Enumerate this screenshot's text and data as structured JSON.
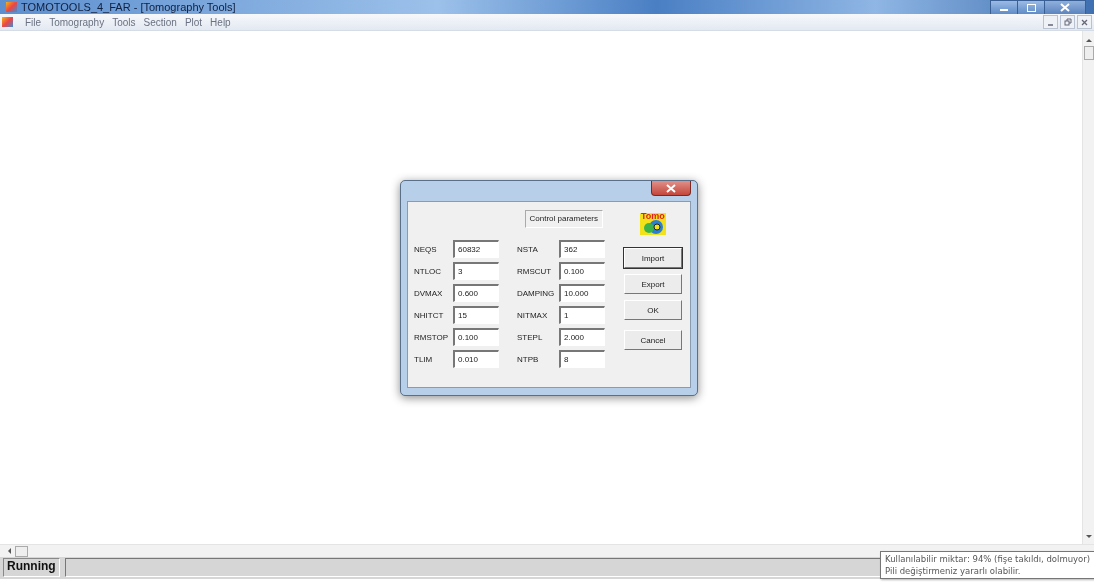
{
  "window": {
    "title": "TOMOTOOLS_4_FAR - [Tomography Tools]"
  },
  "menu": [
    {
      "label": "File"
    },
    {
      "label": "Tomography"
    },
    {
      "label": "Tools"
    },
    {
      "label": "Section"
    },
    {
      "label": "Plot"
    },
    {
      "label": "Help"
    }
  ],
  "dialog": {
    "heading": "Control parameters",
    "logo_text": "Tomo",
    "fields": [
      {
        "label": "NEQS",
        "value": "60832"
      },
      {
        "label": "NSTA",
        "value": "362"
      },
      {
        "label": "NTLOC",
        "value": "3"
      },
      {
        "label": "RMSCUT",
        "value": "0.100"
      },
      {
        "label": "DVMAX",
        "value": "0.600"
      },
      {
        "label": "DAMPING",
        "value": "10.000"
      },
      {
        "label": "NHITCT",
        "value": "15"
      },
      {
        "label": "NITMAX",
        "value": "1"
      },
      {
        "label": "RMSTOP",
        "value": "0.100"
      },
      {
        "label": "STEPL",
        "value": "2.000"
      },
      {
        "label": "TLIM",
        "value": "0.010"
      },
      {
        "label": "NTPB",
        "value": "8"
      }
    ],
    "buttons": [
      {
        "label": "Import",
        "default": true
      },
      {
        "label": "Export",
        "default": false
      },
      {
        "label": "OK",
        "default": false
      },
      {
        "label": "Cancel",
        "default": false
      }
    ]
  },
  "status_bar": {
    "text": "Running"
  },
  "tooltip": {
    "lines": [
      "Kullanılabilir miktar: 94% (fişe takıldı, dolmuyor)",
      "Pili değiştirmeniz yararlı olabilir."
    ]
  }
}
